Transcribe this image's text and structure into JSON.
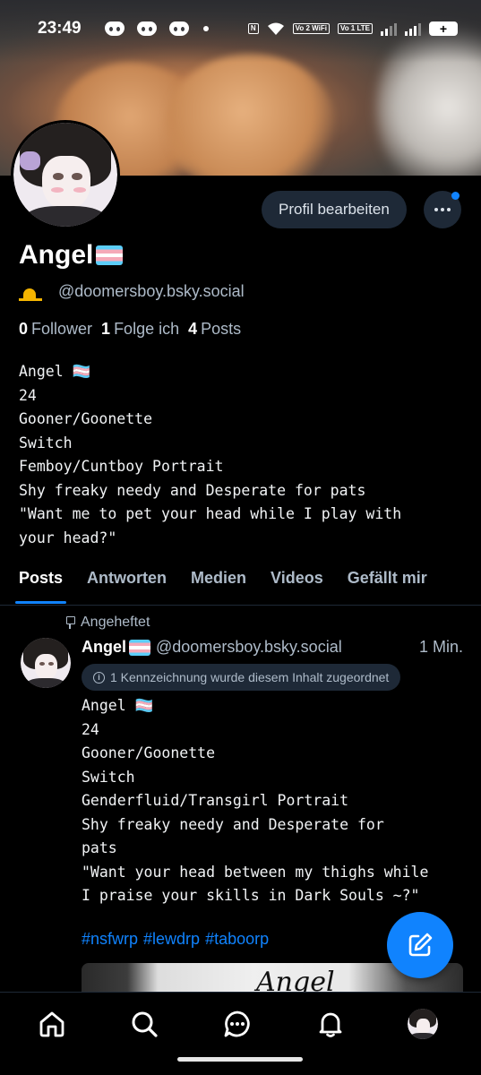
{
  "status_bar": {
    "time": "23:49",
    "network1": "Vo 2 WiFi",
    "network2": "Vo 1 LTE",
    "battery_label": "+"
  },
  "profile": {
    "display_name": "Angel",
    "handle": "@doomersboy.bsky.social",
    "edit_button": "Profil bearbeiten",
    "stats": {
      "followers_count": "0",
      "followers_label": "Follower",
      "following_count": "1",
      "following_label": "Folge ich",
      "posts_count": "4",
      "posts_label": "Posts"
    },
    "bio": "Angel 🏳️‍⚧️\n24\nGooner/Goonette\nSwitch\nFemboy/Cuntboy Portrait\nShy freaky needy and Desperate for pats\n\"Want me to pet your head while I play with\nyour head?\""
  },
  "tabs": [
    {
      "label": "Posts",
      "active": true
    },
    {
      "label": "Antworten",
      "active": false
    },
    {
      "label": "Medien",
      "active": false
    },
    {
      "label": "Videos",
      "active": false
    },
    {
      "label": "Gefällt mir",
      "active": false
    }
  ],
  "post": {
    "pinned_label": "Angeheftet",
    "author_name": "Angel",
    "author_handle": "@doomersboy.bsky.social",
    "time": "1 Min.",
    "label_notice": "1 Kennzeichnung wurde diesem Inhalt zugeordnet",
    "text": "Angel 🏳️‍⚧️\n24\nGooner/Goonette\nSwitch\nGenderfluid/Transgirl Portrait\nShy freaky needy and Desperate for\npats\n\"Want your head between my thighs while\nI praise your skills in Dark Souls ~?\"",
    "hashtags": [
      "#nsfwrp",
      "#lewdrp",
      "#taboorp"
    ],
    "image_text": "Angel"
  },
  "nav": [
    "home-icon",
    "search-icon",
    "chat-icon",
    "bell-icon",
    "profile-avatar"
  ],
  "colors": {
    "accent": "#1083fe",
    "background": "#000000",
    "muted_text": "#aebbc9",
    "button_bg": "#1e2937"
  }
}
